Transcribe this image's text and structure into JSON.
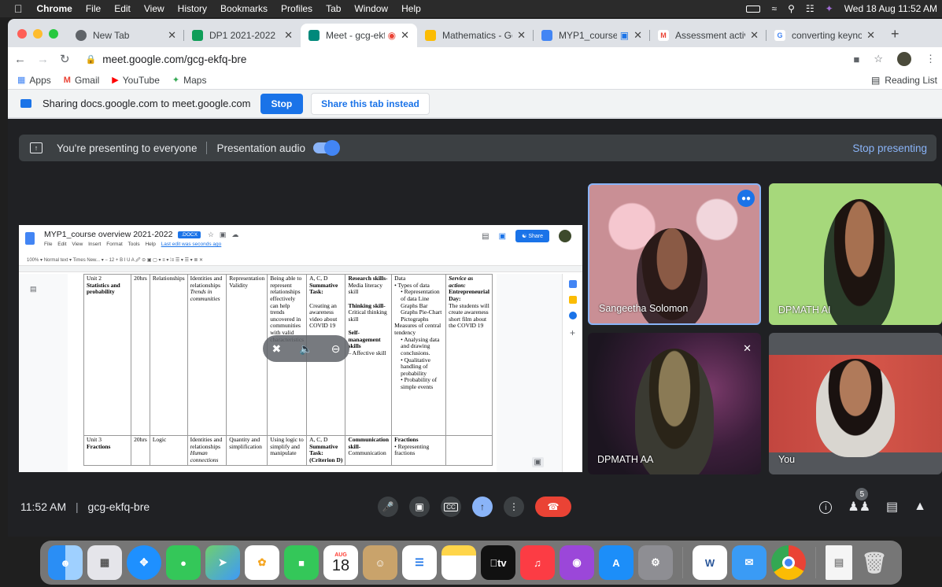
{
  "menubar": {
    "app": "Chrome",
    "items": [
      "File",
      "Edit",
      "View",
      "History",
      "Bookmarks",
      "Profiles",
      "Tab",
      "Window",
      "Help"
    ],
    "clock": "Wed 18 Aug  11:52 AM"
  },
  "tabs": [
    {
      "title": "New Tab",
      "color": "#5f6368"
    },
    {
      "title": "DP1 2021-2022",
      "color": "#0f9d58"
    },
    {
      "title": "Meet - gcg-ekf",
      "color": "#00897b"
    },
    {
      "title": "Mathematics - Goo",
      "color": "#fbbc04"
    },
    {
      "title": "MYP1_course c",
      "color": "#4285f4"
    },
    {
      "title": "Assessment activit",
      "color": "#ea4335"
    },
    {
      "title": "converting keynote",
      "color": "#4285f4"
    }
  ],
  "omnibox": {
    "url": "meet.google.com/gcg-ekfq-bre"
  },
  "bookmarks": {
    "items": [
      "Apps",
      "Gmail",
      "YouTube",
      "Maps"
    ],
    "reading_list": "Reading List"
  },
  "sharebar": {
    "message": "Sharing docs.google.com to meet.google.com",
    "stop": "Stop",
    "share_tab": "Share this tab instead"
  },
  "presenting": {
    "message": "You're presenting to everyone",
    "audio": "Presentation audio",
    "stop": "Stop presenting"
  },
  "doc": {
    "title": "MYP1_course overview 2021-2022",
    "chip": ".DOCX",
    "menu": [
      "File",
      "Edit",
      "View",
      "Insert",
      "Format",
      "Tools",
      "Help"
    ],
    "last_edit": "Last edit was seconds ago",
    "share": "Share",
    "toolbar": "100%  ▾   Normal text  ▾   Times New...  ▾   −  12  +   B  I  U  A   🖉   ⊝  ▣  ▢ ▾   ≡ ▾   ⁞≡   ☰ ▾   ☰ ▾   ≣   ✕",
    "rows": [
      {
        "c1": "Unit 2",
        "c1b": "Statistics and probability",
        "c2": "20hrs",
        "c3": "Relationships",
        "c4": "Identities and relationships",
        "c4i": "Trends in communities",
        "c5": "Representation Validity",
        "c6": "Being able to represent relationships effectively can help trends uncovered in communities with valid characteristics",
        "c7": "A, C, D",
        "c7b": "Summative Task:",
        "c7c": "Creating an awareness video about COVID 19",
        "c8b": "Research skills-",
        "c8": "Media literacy skill",
        "c8b2": "Thinking skill-",
        "c8c": "Critical thinking skill",
        "c8b3": "Self-management skills",
        "c8d": "– Affective skill",
        "c9": "Data",
        "c9list": [
          "Types of data",
          "Representation of data Line Graphs Bar Graphs Pie-Chart Pictographs"
        ],
        "c9b": "Measures of central tendency",
        "c9list2": [
          "Analysing data and drawing conclusions.",
          "Qualitative handling of probability",
          "Probability of simple events"
        ],
        "c10i": "Service as action:",
        "c10b": "Entrepreneurial Day:",
        "c10": "The students will create awareness short film about the COVID 19"
      },
      {
        "c1": "Unit 3",
        "c1b": "Fractions",
        "c2": "20hrs",
        "c3": "Logic",
        "c4": "Identities and relationships",
        "c4i": "Human connections",
        "c5": "Quantity and simplification",
        "c6": "Using logic to simplify and manipulate",
        "c7": "A, C, D",
        "c7b": "Summative Task: (Criterion D)",
        "c8b": "Communication skill-",
        "c8": "Communication",
        "c9b": "Fractions",
        "c9list": [
          "Representing fractions"
        ]
      }
    ]
  },
  "participants": [
    {
      "name": "Sangeetha Solomon"
    },
    {
      "name": "DPMATH AI"
    },
    {
      "name": "DPMATH AA"
    },
    {
      "name": "You"
    }
  ],
  "meeting": {
    "time": "11:52 AM",
    "code": "gcg-ekfq-bre",
    "people_count": "5"
  },
  "dock": {
    "calendar_month": "AUG",
    "calendar_day": "18",
    "tv_label": "tv"
  }
}
